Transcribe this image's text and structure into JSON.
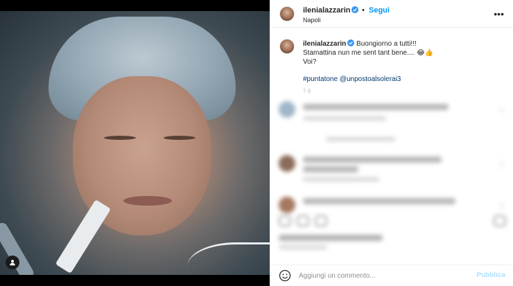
{
  "post": {
    "username": "ilenialazzarin",
    "follow_separator": "•",
    "follow_label": "Segui",
    "location": "Napoli",
    "more_icon": "•••"
  },
  "caption": {
    "username": "ilenialazzarin",
    "line1": "Buongiorno a tutti!!!",
    "line2": "Stamattina nun me sent tant bene.... 😂👍",
    "line3": "Voi?",
    "hashtags": "#puntatone @unpostoalsolerai3",
    "time": "1 g"
  },
  "composer": {
    "placeholder": "Aggiungi un commento...",
    "publish_label": "Pubblica"
  },
  "colors": {
    "link_blue": "#0095f6",
    "verified_blue": "#3897f0",
    "publish_disabled": "#b2dffc",
    "hashtag": "#00376b"
  },
  "icons": {
    "verified": "verified-badge-icon",
    "more": "more-options-icon",
    "user_tag": "user-tag-icon",
    "emoji": "emoji-smile-icon",
    "heart": "heart-icon"
  }
}
